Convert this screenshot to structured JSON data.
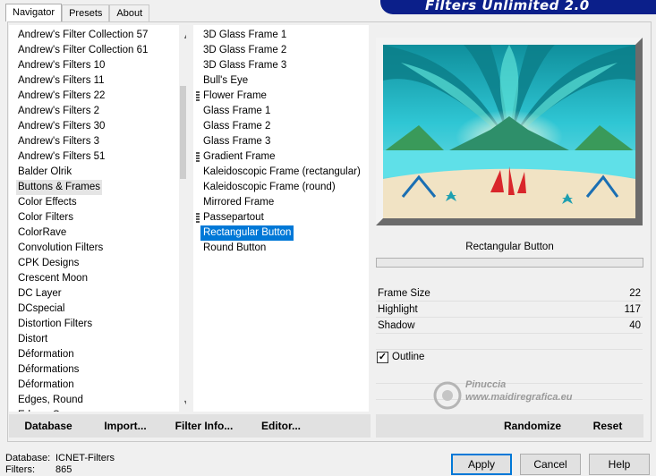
{
  "window": {
    "title": "Filters Unlimited 2.0"
  },
  "tabs": [
    {
      "label": "Navigator",
      "active": true
    },
    {
      "label": "Presets",
      "active": false
    },
    {
      "label": "About",
      "active": false
    }
  ],
  "categories": {
    "selected": "Buttons & Frames",
    "items": [
      "Andrew's Filter Collection 57",
      "Andrew's Filter Collection 61",
      "Andrew's Filters 10",
      "Andrew's Filters 11",
      "Andrew's Filters 22",
      "Andrew's Filters 2",
      "Andrew's Filters 30",
      "Andrew's Filters 3",
      "Andrew's Filters 51",
      "Balder Olrik",
      "Buttons & Frames",
      "Color Effects",
      "Color Filters",
      "ColorRave",
      "Convolution Filters",
      "CPK Designs",
      "Crescent Moon",
      "DC Layer",
      "DCspecial",
      "Distortion Filters",
      "Distort",
      "Déformation",
      "Déformations",
      "Déformation",
      "Edges, Round",
      "Edges, Square"
    ],
    "scroll_up": "▲",
    "scroll_down": "▼"
  },
  "filters": {
    "selected": "Rectangular Button",
    "items": [
      {
        "label": "3D Glass Frame 1",
        "folder": false
      },
      {
        "label": "3D Glass Frame 2",
        "folder": false
      },
      {
        "label": "3D Glass Frame 3",
        "folder": false
      },
      {
        "label": "Bull's Eye",
        "folder": false
      },
      {
        "label": "Flower Frame",
        "folder": true
      },
      {
        "label": "Glass Frame 1",
        "folder": false
      },
      {
        "label": "Glass Frame 2",
        "folder": false
      },
      {
        "label": "Glass Frame 3",
        "folder": false
      },
      {
        "label": "Gradient Frame",
        "folder": true
      },
      {
        "label": "Kaleidoscopic Frame (rectangular)",
        "folder": false
      },
      {
        "label": "Kaleidoscopic Frame (round)",
        "folder": false
      },
      {
        "label": "Mirrored Frame",
        "folder": false
      },
      {
        "label": "Passepartout",
        "folder": true
      },
      {
        "label": "Rectangular Button",
        "folder": false
      },
      {
        "label": "Round Button",
        "folder": false
      }
    ]
  },
  "preview": {
    "filter_name": "Rectangular Button",
    "colors": {
      "sky": "#1fb8c9",
      "teal": "#13a7a0",
      "sand": "#f1e3c4",
      "water": "#5fe0e8",
      "frame_light": "#f3f3f3",
      "frame_dark": "#6b6b6b"
    }
  },
  "params": [
    {
      "name": "Frame Size",
      "value": "22"
    },
    {
      "name": "Highlight",
      "value": "117"
    },
    {
      "name": "Shadow",
      "value": "40"
    }
  ],
  "outline": {
    "label": "Outline",
    "checked": true,
    "check_glyph": "✓"
  },
  "watermark": {
    "line1": "Pinuccia",
    "line2": "www.maidiregrafica.eu"
  },
  "bottom_buttons": {
    "database": "Database",
    "import": "Import...",
    "filter_info": "Filter Info...",
    "editor": "Editor...",
    "randomize": "Randomize",
    "reset": "Reset"
  },
  "status": {
    "database_label": "Database:",
    "database_value": "ICNET-Filters",
    "filters_label": "Filters:",
    "filters_value": "865"
  },
  "dialog_buttons": {
    "apply": "Apply",
    "cancel": "Cancel",
    "help": "Help"
  }
}
